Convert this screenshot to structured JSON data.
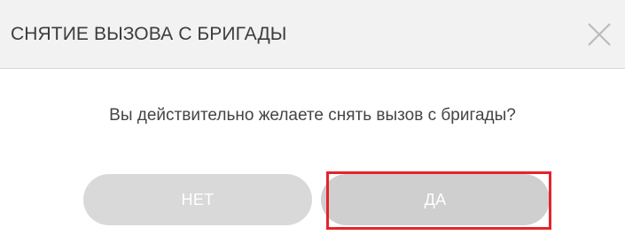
{
  "dialog": {
    "title": "СНЯТИЕ ВЫЗОВА С БРИГАДЫ",
    "close_icon": "close-icon",
    "message": "Вы действительно желаете снять вызов с бригады?",
    "buttons": {
      "no_label": "НЕТ",
      "yes_label": "ДА"
    }
  },
  "colors": {
    "header_bg": "#f2f2f2",
    "button_bg": "#d9d9d9",
    "button_text": "#ffffff",
    "highlight": "#e4242b"
  }
}
